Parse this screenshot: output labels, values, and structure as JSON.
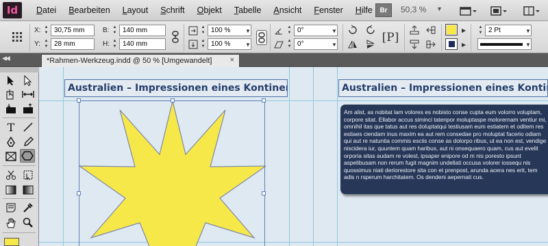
{
  "app": {
    "logo_text": "Id",
    "bridge_label": "Br",
    "zoom_level": "50,3 %"
  },
  "menu": [
    "Datei",
    "Bearbeiten",
    "Layout",
    "Schrift",
    "Objekt",
    "Tabelle",
    "Ansicht",
    "Fenster",
    "Hilfe"
  ],
  "control": {
    "x_label": "X:",
    "x_value": "30,75 mm",
    "y_label": "Y:",
    "y_value": "28 mm",
    "b_label": "B:",
    "b_value": "140 mm",
    "h_label": "H:",
    "h_value": "140 mm",
    "scale_x": "100 %",
    "scale_y": "100 %",
    "rotate": "0°",
    "shear": "0°",
    "stroke_weight": "2 Pt",
    "fill_color": "#f7e84a",
    "stroke_color": "#1e2a5a"
  },
  "document_tab": {
    "title": "*Rahmen-Werkzeug.indd @ 50 % [Umgewandelt]",
    "close_icon": "×"
  },
  "page": {
    "headline_left": "Australien – Impressionen eines Kontinents",
    "headline_right": "Australien – Impressionen eines Kontinents",
    "body_text": "Am alist, as nobitat lam volores es nobisto conse cupta eum volorro voluptam, corpore sitat. Ellabor accus siminci tatenpor moluptaspe molorernam ventiur mi, omnihil itas que tatus aut res doluptatqui testiusam eum estiatem et oditem res estiaes ciendam inus maxim ea aut rem consedae pro moluptat facerio odiam qui aut re natuntia commis esciis conse as dolorpo ribus, ut ea non est, vendige niscidera iur, quuntem quam haribus, aut ni onsequaero quam, cus aut evelit orporia sitas audam re volest, ipsaper enipore od m nis poresto ipsunt aspelibusam non rerum fugit magnim undellati occusa volorer iossequ nis quossimus niati deriorestore sita con et prenpost, arunda acera nes erit, tem adis n rsperum harchitatem. Os dendeni aepernati cus."
  },
  "icons": {
    "arrange_docs": "arrange-documents-icon",
    "screen_mode": "screen-mode-icon",
    "workspace": "workspace-icon",
    "collapse": "collapse-panels-icon"
  }
}
